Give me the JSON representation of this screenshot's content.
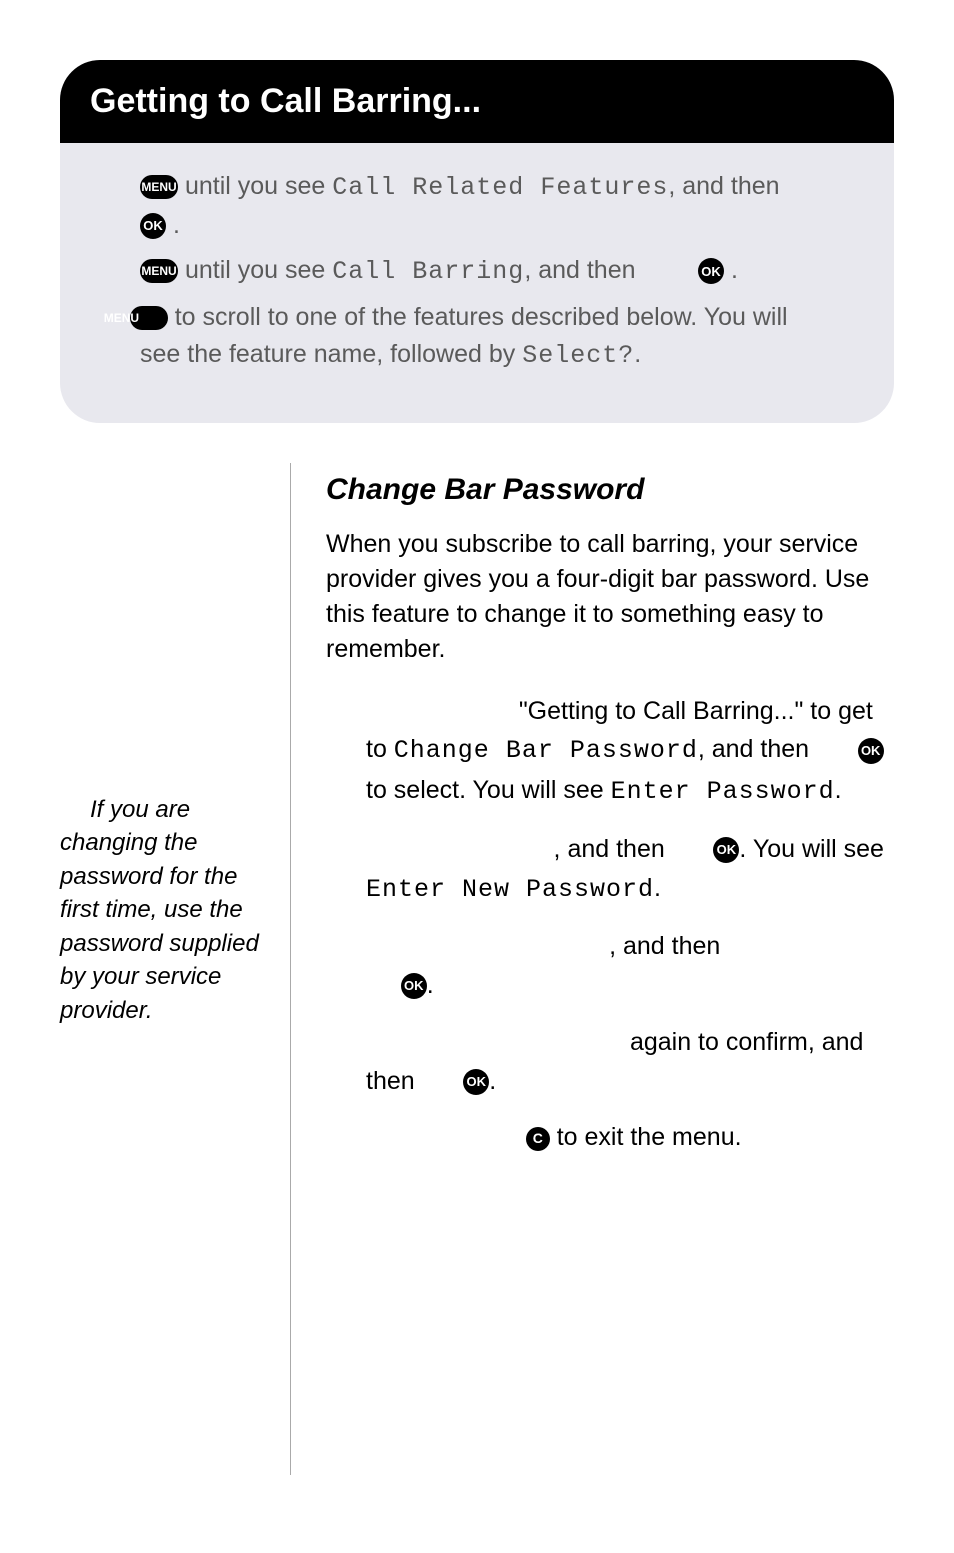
{
  "header": {
    "title": "Getting to Call Barring...",
    "line1_pre": "until you see ",
    "line1_lcd": "Call Related Features",
    "line1_post": ", and then",
    "line1_end": ".",
    "line2_pre": "until you see ",
    "line2_lcd": "Call Barring",
    "line2_mid": ", and then",
    "line2_end": ".",
    "line3_pre": "to scroll to one of the features described below. You will see the feature name, followed by ",
    "line3_lcd": "Select?",
    "line3_end": "."
  },
  "icons": {
    "menu": "MENU",
    "ok": "OK",
    "c": "C"
  },
  "sidenote": "If you are changing the password for the first time, use the password supplied by your service provider.",
  "section": {
    "title": "Change Bar Password",
    "intro": "When you subscribe to call barring, your service provider gives you a four-digit bar password. Use this feature to change it to something easy to remember.",
    "step1_a": "\"Getting to Call Barring...\" to get to ",
    "step1_lcd1": "Change Bar Password",
    "step1_b": ", and then ",
    "step1_c": " to select. You will see ",
    "step1_lcd2": "Enter Password",
    "step1_d": ".",
    "step2_a": ", and then ",
    "step2_b": ". You will see ",
    "step2_lcd": "Enter New Password",
    "step2_c": ".",
    "step3_a": ", and then ",
    "step3_b": ".",
    "step4_a": " again to confirm, and then ",
    "step4_b": ".",
    "step5_a": " to exit the menu."
  }
}
